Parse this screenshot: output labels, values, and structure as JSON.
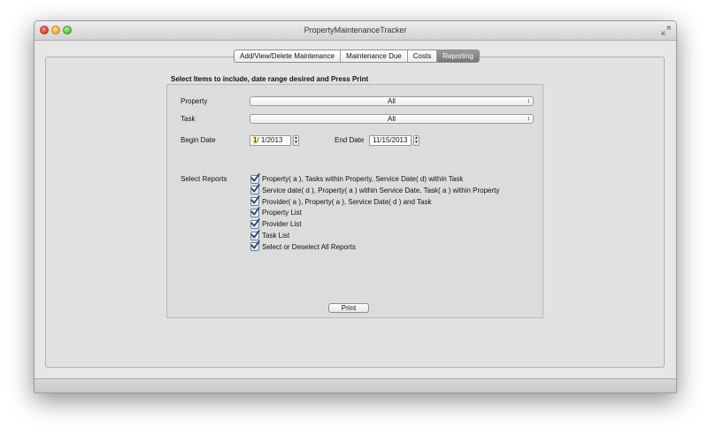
{
  "window": {
    "title": "PropertyMaintenanceTracker"
  },
  "tabs": [
    {
      "label": "Add/View/Delete Maintenance",
      "active": false
    },
    {
      "label": "Maintenance Due",
      "active": false
    },
    {
      "label": "Costs",
      "active": false
    },
    {
      "label": "Reporting",
      "active": true
    }
  ],
  "reporting": {
    "instructions": "Select Items to include, date range desired and Press Print",
    "property_label": "Property",
    "property_value": "All",
    "task_label": "Task",
    "task_value": "All",
    "begin_date_label": "Begin Date",
    "begin_date_month": "1",
    "begin_date_rest": "/  1/2013",
    "end_date_label": "End Date",
    "end_date_value": "11/15/2013",
    "select_reports_label": "Select Reports",
    "reports": [
      {
        "label": "Property( a ), Tasks within Property, Service Date( d) within Task",
        "checked": true
      },
      {
        "label": "Service date( d ), Property( a ) within Service Date, Task( a ) within Property",
        "checked": true
      },
      {
        "label": "Provider( a ), Property( a ), Service Date( d ) and Task",
        "checked": true
      },
      {
        "label": "Property List",
        "checked": true
      },
      {
        "label": "Provider List",
        "checked": true
      },
      {
        "label": "Task List",
        "checked": true
      },
      {
        "label": "Select or Deselect All Reports",
        "checked": true
      }
    ],
    "print_label": "Print"
  },
  "icons": {
    "close": "close-icon",
    "minimize": "minimize-icon",
    "zoom": "zoom-icon",
    "fullscreen": "fullscreen-icon",
    "checkmark": "checkmark-icon",
    "popup_arrows": "updown-arrows-icon"
  },
  "colors": {
    "active_tab": "#888888",
    "date_highlight": "#ffe96b",
    "checkmark": "#1f3f73"
  }
}
